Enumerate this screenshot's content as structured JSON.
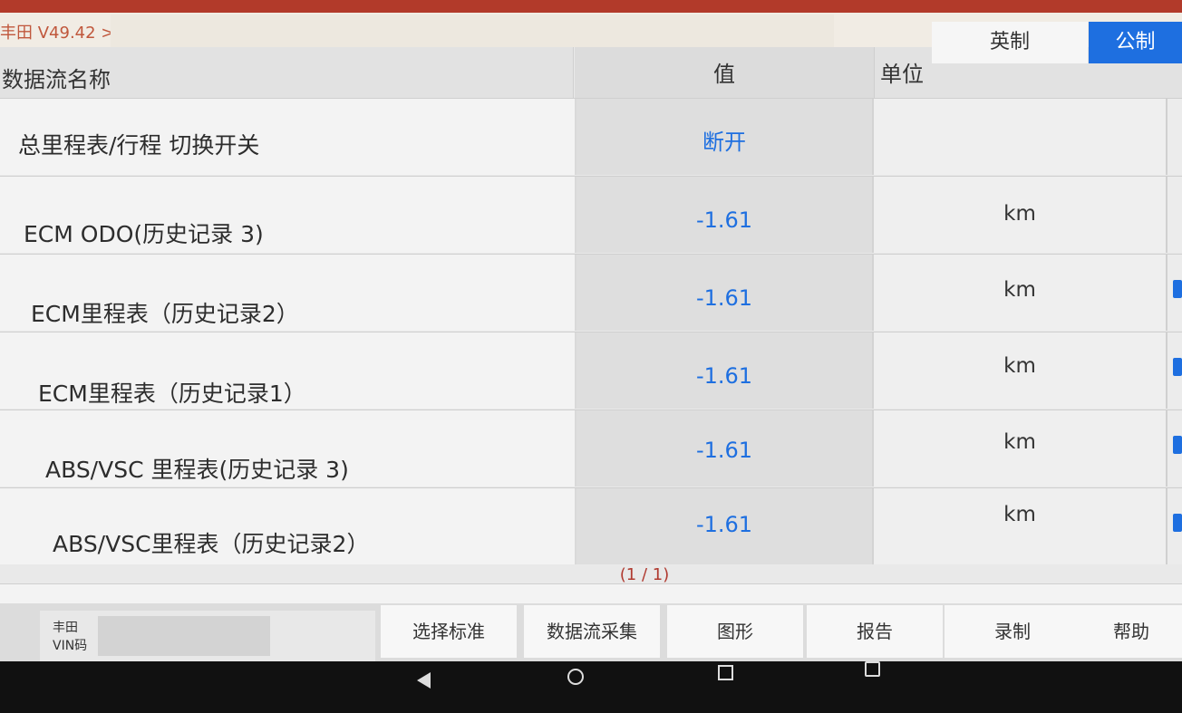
{
  "breadcrumb": {
    "app_version": "丰田 V49.42 >"
  },
  "header": {
    "name_col": "数据流名称",
    "value_col": "值",
    "unit_label": "单位",
    "unit_imperial": "英制",
    "unit_metric": "公制",
    "selected_unit": "公制"
  },
  "rows": [
    {
      "name": "总里程表/行程 切换开关",
      "value": "断开",
      "unit": ""
    },
    {
      "name": "ECM ODO(历史记录 3)",
      "value": "-1.61",
      "unit": "km"
    },
    {
      "name": "ECM里程表（历史记录2）",
      "value": "-1.61",
      "unit": "km"
    },
    {
      "name": "ECM里程表（历史记录1）",
      "value": "-1.61",
      "unit": "km"
    },
    {
      "name": "ABS/VSC 里程表(历史记录 3)",
      "value": "-1.61",
      "unit": "km"
    },
    {
      "name": "ABS/VSC里程表（历史记录2）",
      "value": "-1.61",
      "unit": "km"
    }
  ],
  "pager": "(1 / 1)",
  "vehicle": {
    "make": "丰田",
    "vin_label": "VIN码"
  },
  "toolbar": {
    "select_standard": "选择标准",
    "datastream_capture": "数据流采集",
    "graph": "图形",
    "report": "报告",
    "record": "录制",
    "help": "帮助"
  },
  "colors": {
    "accent": "#1e6fe0",
    "pager": "#b03a30",
    "title": "#c0573c"
  }
}
